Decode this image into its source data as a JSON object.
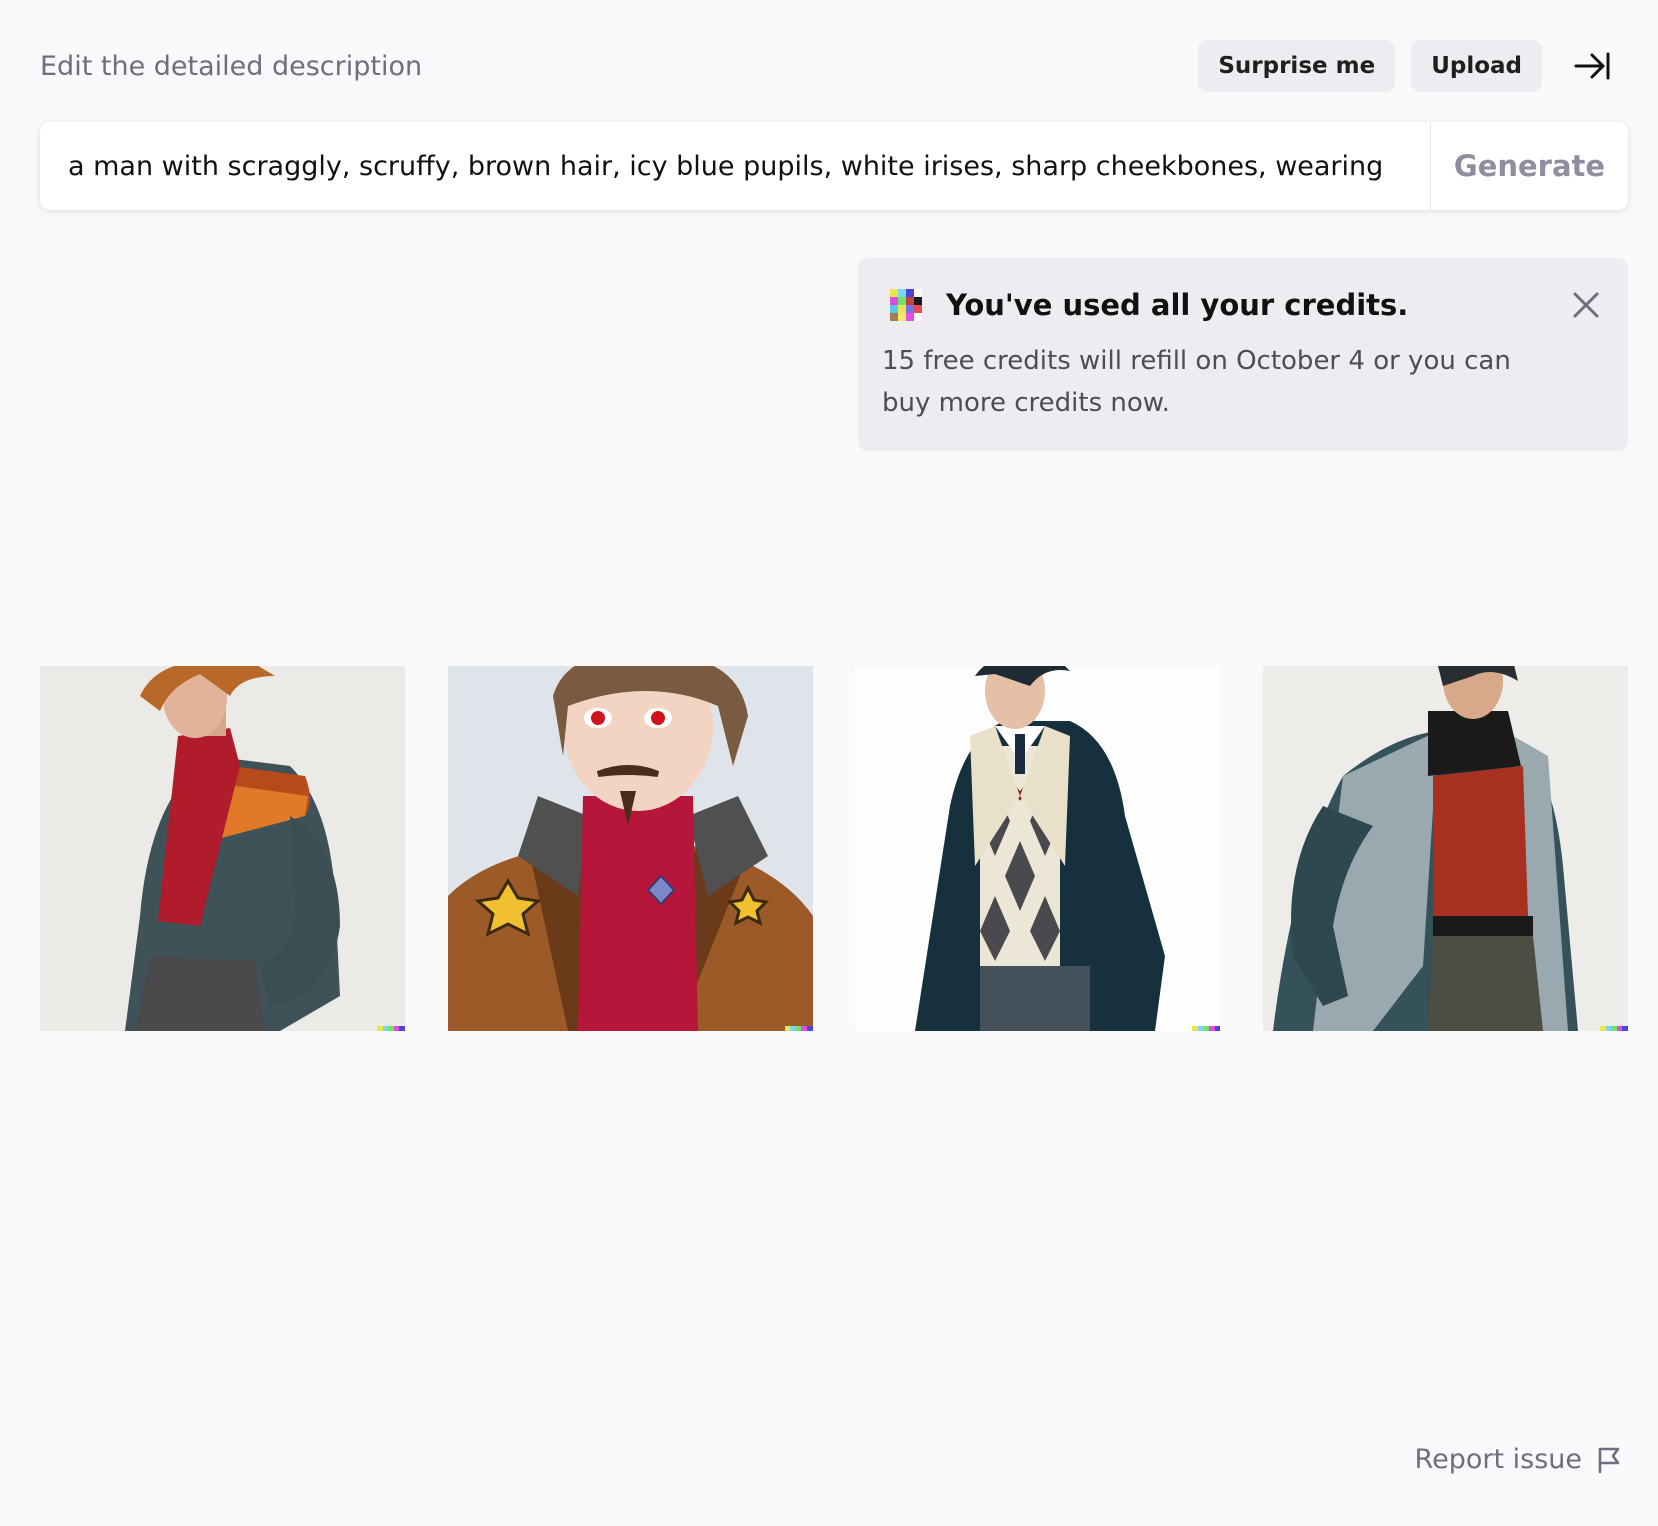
{
  "header": {
    "title": "Edit the detailed description",
    "surprise_label": "Surprise me",
    "upload_label": "Upload"
  },
  "prompt": {
    "value": "a man with scraggly, scruffy, brown hair, icy blue pupils, white irises, sharp cheekbones, wearing",
    "generate_label": "Generate"
  },
  "notice": {
    "title": "You've used all your credits.",
    "body": "15 free credits will refill on October 4 or you can buy more credits now."
  },
  "images": [
    {
      "name": "generated-image-1"
    },
    {
      "name": "generated-image-2"
    },
    {
      "name": "generated-image-3"
    },
    {
      "name": "generated-image-4"
    }
  ],
  "footer": {
    "report_label": "Report issue"
  },
  "colors": {
    "background": "#f9f9fb",
    "notice_bg": "#ececf1",
    "button_bg": "#ececf1",
    "muted_text": "#6e6e80"
  }
}
